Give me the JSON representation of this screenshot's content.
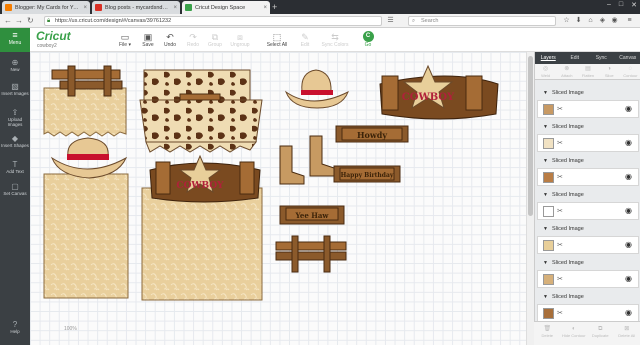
{
  "browser": {
    "tabs": [
      {
        "title": "Blogger: My Cards for You...",
        "favicon_color": "#f57d00"
      },
      {
        "title": "Blog posts - mycardsnd@...",
        "favicon_color": "#d93025"
      },
      {
        "title": "Cricut Design Space",
        "favicon_color": "#3aa14a"
      }
    ],
    "new_tab": "+",
    "url": "https://us.cricut.com/design/#/canvas/39761232",
    "search_placeholder": "Search"
  },
  "app": {
    "menu_label": "Menu",
    "logo": "Cricut",
    "project_name": "cowboy2",
    "toolbar": [
      {
        "label": "File",
        "icon": "folder-icon",
        "enabled": true
      },
      {
        "label": "Save",
        "icon": "save-icon",
        "enabled": true
      },
      {
        "label": "Undo",
        "icon": "undo-icon",
        "enabled": true
      },
      {
        "label": "Redo",
        "icon": "redo-icon",
        "enabled": false
      },
      {
        "label": "Group",
        "icon": "group-icon",
        "enabled": false
      },
      {
        "label": "Ungroup",
        "icon": "ungroup-icon",
        "enabled": false
      },
      {
        "label": "Select All",
        "icon": "select-all-icon",
        "enabled": true
      },
      {
        "label": "Edit",
        "icon": "edit-icon",
        "enabled": false
      },
      {
        "label": "Sync Colors",
        "icon": "sync-icon",
        "enabled": false
      }
    ],
    "go_label": "Go"
  },
  "left_tools": [
    {
      "label": "New",
      "icon": "new-icon"
    },
    {
      "label": "Insert Images",
      "icon": "images-icon"
    },
    {
      "label": "Upload Images",
      "icon": "upload-icon"
    },
    {
      "label": "Insert Shapes",
      "icon": "shapes-icon"
    },
    {
      "label": "Add Text",
      "icon": "text-icon"
    },
    {
      "label": "Set Canvas",
      "icon": "canvas-icon"
    },
    {
      "label": "Help",
      "icon": "help-icon"
    }
  ],
  "canvas": {
    "signs": [
      "Howdy",
      "Happy Birthday",
      "Yee Haw",
      "COWBOY",
      "COWBOY"
    ],
    "zoom_label": "100%"
  },
  "layers_panel": {
    "tabs": [
      "Layers",
      "Edit",
      "Sync",
      "Canvas"
    ],
    "active_tab": "Layers",
    "tools": [
      "Weld",
      "Attach",
      "Flatten",
      "Slice",
      "Contour"
    ],
    "layers": [
      {
        "name": "Sliced Image"
      },
      {
        "name": "Sliced Image"
      },
      {
        "name": "Sliced Image"
      },
      {
        "name": "Sliced Image"
      },
      {
        "name": "Sliced Image"
      },
      {
        "name": "Sliced Image"
      },
      {
        "name": "Sliced Image"
      }
    ],
    "bottom_tools": [
      "Delete",
      "Hide Contour",
      "Duplicate",
      "Delete All"
    ]
  }
}
